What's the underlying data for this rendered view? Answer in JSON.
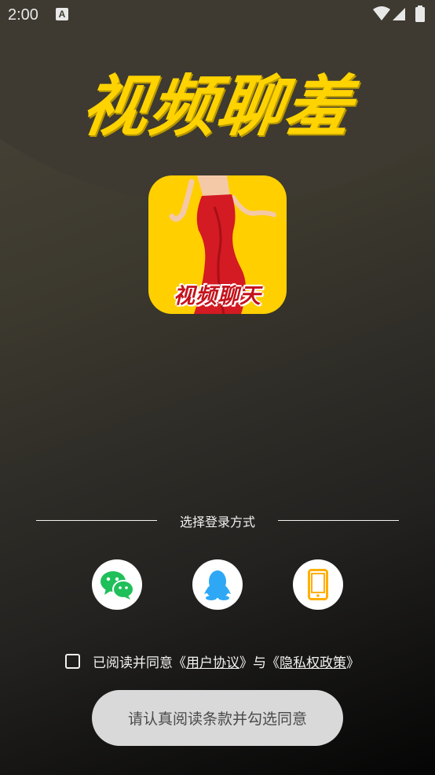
{
  "status_bar": {
    "time": "2:00",
    "notification_icon": "a-icon",
    "icons": [
      "wifi-icon",
      "signal-icon",
      "battery-icon"
    ]
  },
  "app": {
    "title": "视频聊羞",
    "logo_text": "视频聊天",
    "accent_color": "#ffd300",
    "logo_bg_color": "#ffcf00"
  },
  "login": {
    "label": "选择登录方式",
    "methods": [
      {
        "name": "wechat",
        "icon": "wechat-icon",
        "color": "#1fbf5a"
      },
      {
        "name": "qq",
        "icon": "qq-penguin-icon",
        "color": "#2ea8f5"
      },
      {
        "name": "phone",
        "icon": "phone-icon",
        "color": "#ffae00"
      }
    ]
  },
  "agreement": {
    "prefix": "已阅读并同意",
    "open1": "《",
    "user_agreement": "用户协议",
    "close1": "》",
    "joiner": "与",
    "open2": "《",
    "privacy_policy": "隐私权政策",
    "close2": "》",
    "checked": false
  },
  "confirm_button": {
    "label": "请认真阅读条款并勾选同意"
  }
}
